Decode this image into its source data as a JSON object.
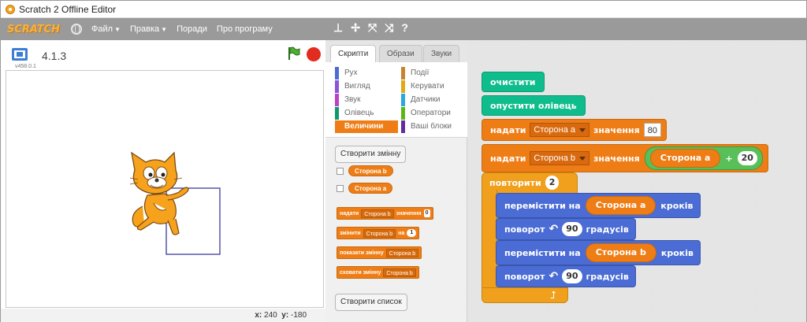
{
  "window": {
    "title": "Scratch 2 Offline Editor"
  },
  "menubar": {
    "logo": "SCRATCH",
    "items": [
      {
        "label": "Файл",
        "arrow": "▼"
      },
      {
        "label": "Правка",
        "arrow": "▼"
      },
      {
        "label": "Поради",
        "arrow": ""
      },
      {
        "label": "Про програму",
        "arrow": ""
      }
    ],
    "tool_icons": [
      "duplicate-icon",
      "cut-icon",
      "grow-icon",
      "shrink-icon",
      "help-icon"
    ]
  },
  "stage": {
    "version": "4.1.3",
    "build": "v458.0.1",
    "coords": {
      "x_label": "x:",
      "x": "240",
      "y_label": "y:",
      "y": "-180"
    }
  },
  "tabs": [
    "Скрипти",
    "Образи",
    "Звуки"
  ],
  "categories": [
    {
      "label": "Рух",
      "color": "#4a6cd4"
    },
    {
      "label": "Події",
      "color": "#c88330"
    },
    {
      "label": "Вигляд",
      "color": "#8a55d7"
    },
    {
      "label": "Керувати",
      "color": "#e1a91a"
    },
    {
      "label": "Звук",
      "color": "#bb42c3"
    },
    {
      "label": "Датчики",
      "color": "#2ca5e2"
    },
    {
      "label": "Олівець",
      "color": "#0e9a6c"
    },
    {
      "label": "Оператори",
      "color": "#5cb712"
    },
    {
      "label": "Величини",
      "color": "#ee7d16"
    },
    {
      "label": "Ваші блоки",
      "color": "#632d99"
    }
  ],
  "palette": {
    "make_variable": "Створити змінну",
    "variables": [
      "Сторона b",
      "Сторона a"
    ],
    "set_block": {
      "op": "надати",
      "var": "Сторона b",
      "to": "значення",
      "val": "0"
    },
    "change_block": {
      "op": "змінити",
      "var": "Сторона b",
      "by": "на",
      "val": "1"
    },
    "show_block": {
      "op": "показати змінну",
      "var": "Сторона b"
    },
    "hide_block": {
      "op": "сховати змінну",
      "var": "Сторона b"
    },
    "make_list": "Створити список"
  },
  "script": {
    "clear": "очистити",
    "pen_down": "опустити олівець",
    "set1": {
      "op": "надати",
      "var": "Сторона a",
      "to": "значення",
      "val": "80"
    },
    "set2": {
      "op": "надати",
      "var": "Сторона b",
      "to": "значення",
      "var2": "Сторона a",
      "plus": "+",
      "val": "20"
    },
    "repeat": {
      "label": "повторити",
      "count": "2"
    },
    "move1": {
      "op": "перемістити на",
      "var": "Сторона a",
      "unit": "кроків"
    },
    "turn1": {
      "op": "поворот",
      "val": "90",
      "unit": "градусів"
    },
    "move2": {
      "op": "перемістити на",
      "var": "Сторона b",
      "unit": "кроків"
    },
    "turn2": {
      "op": "поворот",
      "val": "90",
      "unit": "градусів"
    }
  }
}
